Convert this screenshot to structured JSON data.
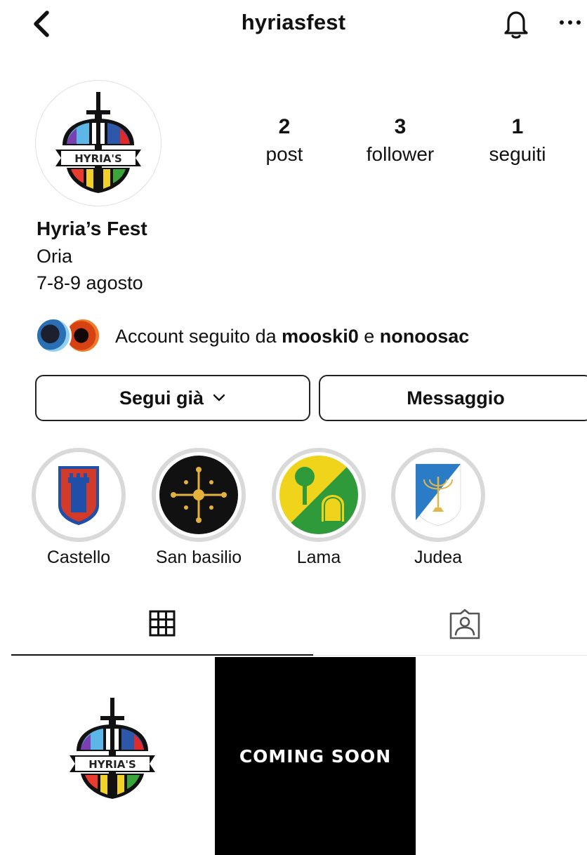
{
  "header": {
    "username": "hyriasfest",
    "back_icon": "chevron-left-icon",
    "bell_icon": "bell-icon",
    "more_icon": "more-horizontal-icon"
  },
  "profile": {
    "avatar_logo_text": "HYRIA'S",
    "stats": [
      {
        "value": "2",
        "label": "post"
      },
      {
        "value": "3",
        "label": "follower"
      },
      {
        "value": "1",
        "label": "seguiti"
      }
    ],
    "display_name": "Hyria’s Fest",
    "bio_lines": [
      "Oria",
      "7-8-9 agosto"
    ]
  },
  "followed_by": {
    "prefix": "Account seguito da ",
    "user1": "mooski0",
    "conjunction": " e ",
    "user2": "nonoosac"
  },
  "actions": {
    "follow_label": "Segui già",
    "message_label": "Messaggio"
  },
  "highlights": [
    {
      "label": "Castello"
    },
    {
      "label": "San basilio"
    },
    {
      "label": "Lama"
    },
    {
      "label": "Judea"
    }
  ],
  "tabs": {
    "grid_icon": "grid-icon",
    "tagged_icon": "tagged-person-icon",
    "active": "grid"
  },
  "posts": [
    {
      "type": "logo",
      "logo_text": "HYRIA'S"
    },
    {
      "type": "text",
      "text": "COMING SOON"
    }
  ],
  "colors": {
    "text": "#111111",
    "border": "#222222",
    "ring": "#d9d9d9"
  }
}
